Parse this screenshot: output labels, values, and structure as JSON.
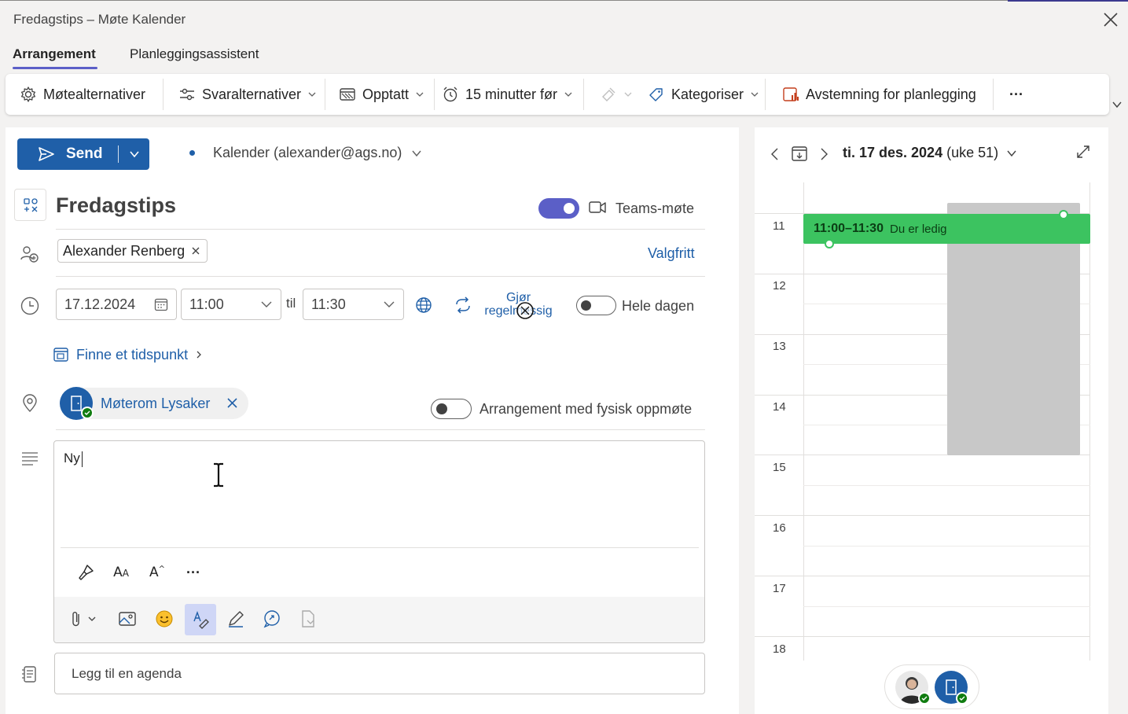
{
  "window": {
    "title": "Fredagstips – Møte Kalender"
  },
  "tabs": [
    {
      "label": "Arrangement"
    },
    {
      "label": "Planleggingsassistent"
    }
  ],
  "ribbon": {
    "meeting_options": "Møtealternativer",
    "response_options": "Svaralternativer",
    "show_as": "Opptatt",
    "reminder": "15 minutter før",
    "categorize": "Kategoriser",
    "poll": "Avstemning for planlegging",
    "more": "···"
  },
  "compose": {
    "send_label": "Send",
    "calendar": "Kalender (alexander@ags.no)",
    "event_title": "Fredagstips",
    "teams_meeting_label": "Teams-møte",
    "teams_meeting_on": true,
    "attendee": "Alexander Renberg",
    "optional_link": "Valgfritt",
    "start_date": "17.12.2024",
    "start_time": "11:00",
    "to_label": "til",
    "end_time": "11:30",
    "recurring_label_line1": "Gjør",
    "recurring_label_line2": "regelmessig",
    "all_day_label": "Hele dagen",
    "all_day_on": false,
    "find_time": "Finne et tidspunkt",
    "location": "Møterom Lysaker",
    "in_person_label": "Arrangement med fysisk oppmøte",
    "in_person_on": false,
    "body_text": "Ny",
    "agenda_placeholder": "Legg til en agenda",
    "format_more": "···"
  },
  "day_view": {
    "date_label": "ti. 17 des. 2024",
    "week_label": "(uke 51)",
    "hours": [
      "11",
      "12",
      "13",
      "14",
      "15",
      "16",
      "17",
      "18"
    ],
    "event_time": "11:00–11:30",
    "event_status": "Du er ledig"
  },
  "colors": {
    "brand_blue": "#1f5fa8",
    "teams_purple": "#5b5fc7",
    "free_green": "#3cc360",
    "busy_gray": "#c8c8c8"
  }
}
